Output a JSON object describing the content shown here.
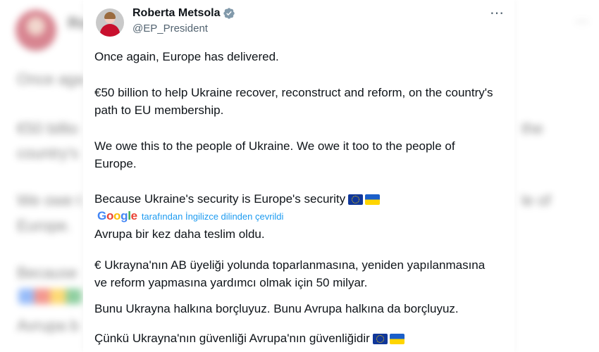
{
  "background": {
    "avatar_name_partial": "Ro",
    "lines_left": [
      "Once aga",
      "€50 billio",
      "country's",
      "We owe t",
      "Europe.",
      "Because",
      "Avrupa b"
    ],
    "lines_right": [
      "the",
      "le of"
    ]
  },
  "tweet": {
    "display_name": "Roberta Metsola",
    "handle": "@EP_President",
    "verified": true,
    "more_icon": "⋯",
    "paragraphs": {
      "p1": "Once again, Europe has delivered.",
      "p2": "€50 billion to help Ukraine recover, reconstruct and reform, on the country's path to EU membership.",
      "p3": "We owe this to the people of Ukraine. We owe it too to the people of Europe.",
      "p4": "Because Ukraine's security is Europe's security"
    },
    "translation": {
      "provider_label": "Google",
      "note": "tarafından İngilizce dilinden çevrildi",
      "paragraphs": {
        "t1": "Avrupa bir kez daha teslim oldu.",
        "t2": "€ Ukrayna'nın AB üyeliği yolunda toparlanmasına, yeniden yapılanmasına ve reform yapmasına yardımcı olmak için 50 milyar.",
        "t3": "Bunu Ukrayna halkına borçluyuz. Bunu Avrupa halkına da borçluyuz.",
        "t4": "Çünkü Ukrayna'nın güvenliği Avrupa'nın güvenliğidir"
      }
    },
    "flags": [
      "eu-flag-icon",
      "ukraine-flag-icon"
    ]
  },
  "colors": {
    "text": "#0f1419",
    "secondary": "#536471",
    "link": "#1d9bf0",
    "verified": "#829aab"
  }
}
